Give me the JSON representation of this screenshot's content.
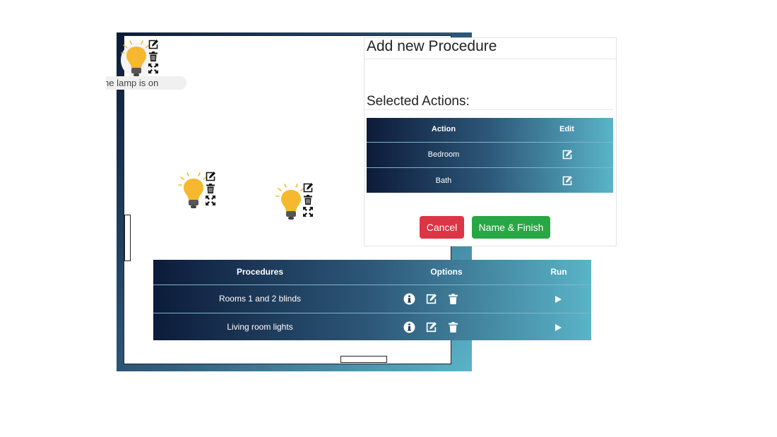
{
  "floorplan": {
    "lamps": [
      {
        "id": "lamp-1",
        "state": "on",
        "tooltip": "he lamp is on"
      },
      {
        "id": "lamp-2",
        "state": "on"
      },
      {
        "id": "lamp-3",
        "state": "on"
      }
    ],
    "lamp_tools": [
      "edit-icon",
      "trash-icon",
      "move-icon"
    ]
  },
  "dialog": {
    "title": "Add new Procedure",
    "selected_heading": "Selected Actions:",
    "actions_table": {
      "headers": [
        "Action",
        "Edit"
      ],
      "rows": [
        {
          "action": "Bedroom",
          "edit_icon": "edit-icon"
        },
        {
          "action": "Bath",
          "edit_icon": "edit-icon"
        }
      ]
    },
    "cancel_label": "Cancel",
    "finish_label": "Name & Finish"
  },
  "procedures_table": {
    "headers": [
      "Procedures",
      "Options",
      "Run"
    ],
    "rows": [
      {
        "name": "Rooms 1 and 2 blinds",
        "options": [
          "info-icon",
          "edit-icon",
          "trash-icon"
        ],
        "run": "play-icon"
      },
      {
        "name": "Living room lights",
        "options": [
          "info-icon",
          "edit-icon",
          "trash-icon"
        ],
        "run": "play-icon"
      }
    ]
  },
  "colors": {
    "gradient_start": "#0d1b3a",
    "gradient_end": "#5ab4c8",
    "cancel": "#dc3545",
    "finish": "#28a745",
    "bulb": "#f5b82e"
  }
}
